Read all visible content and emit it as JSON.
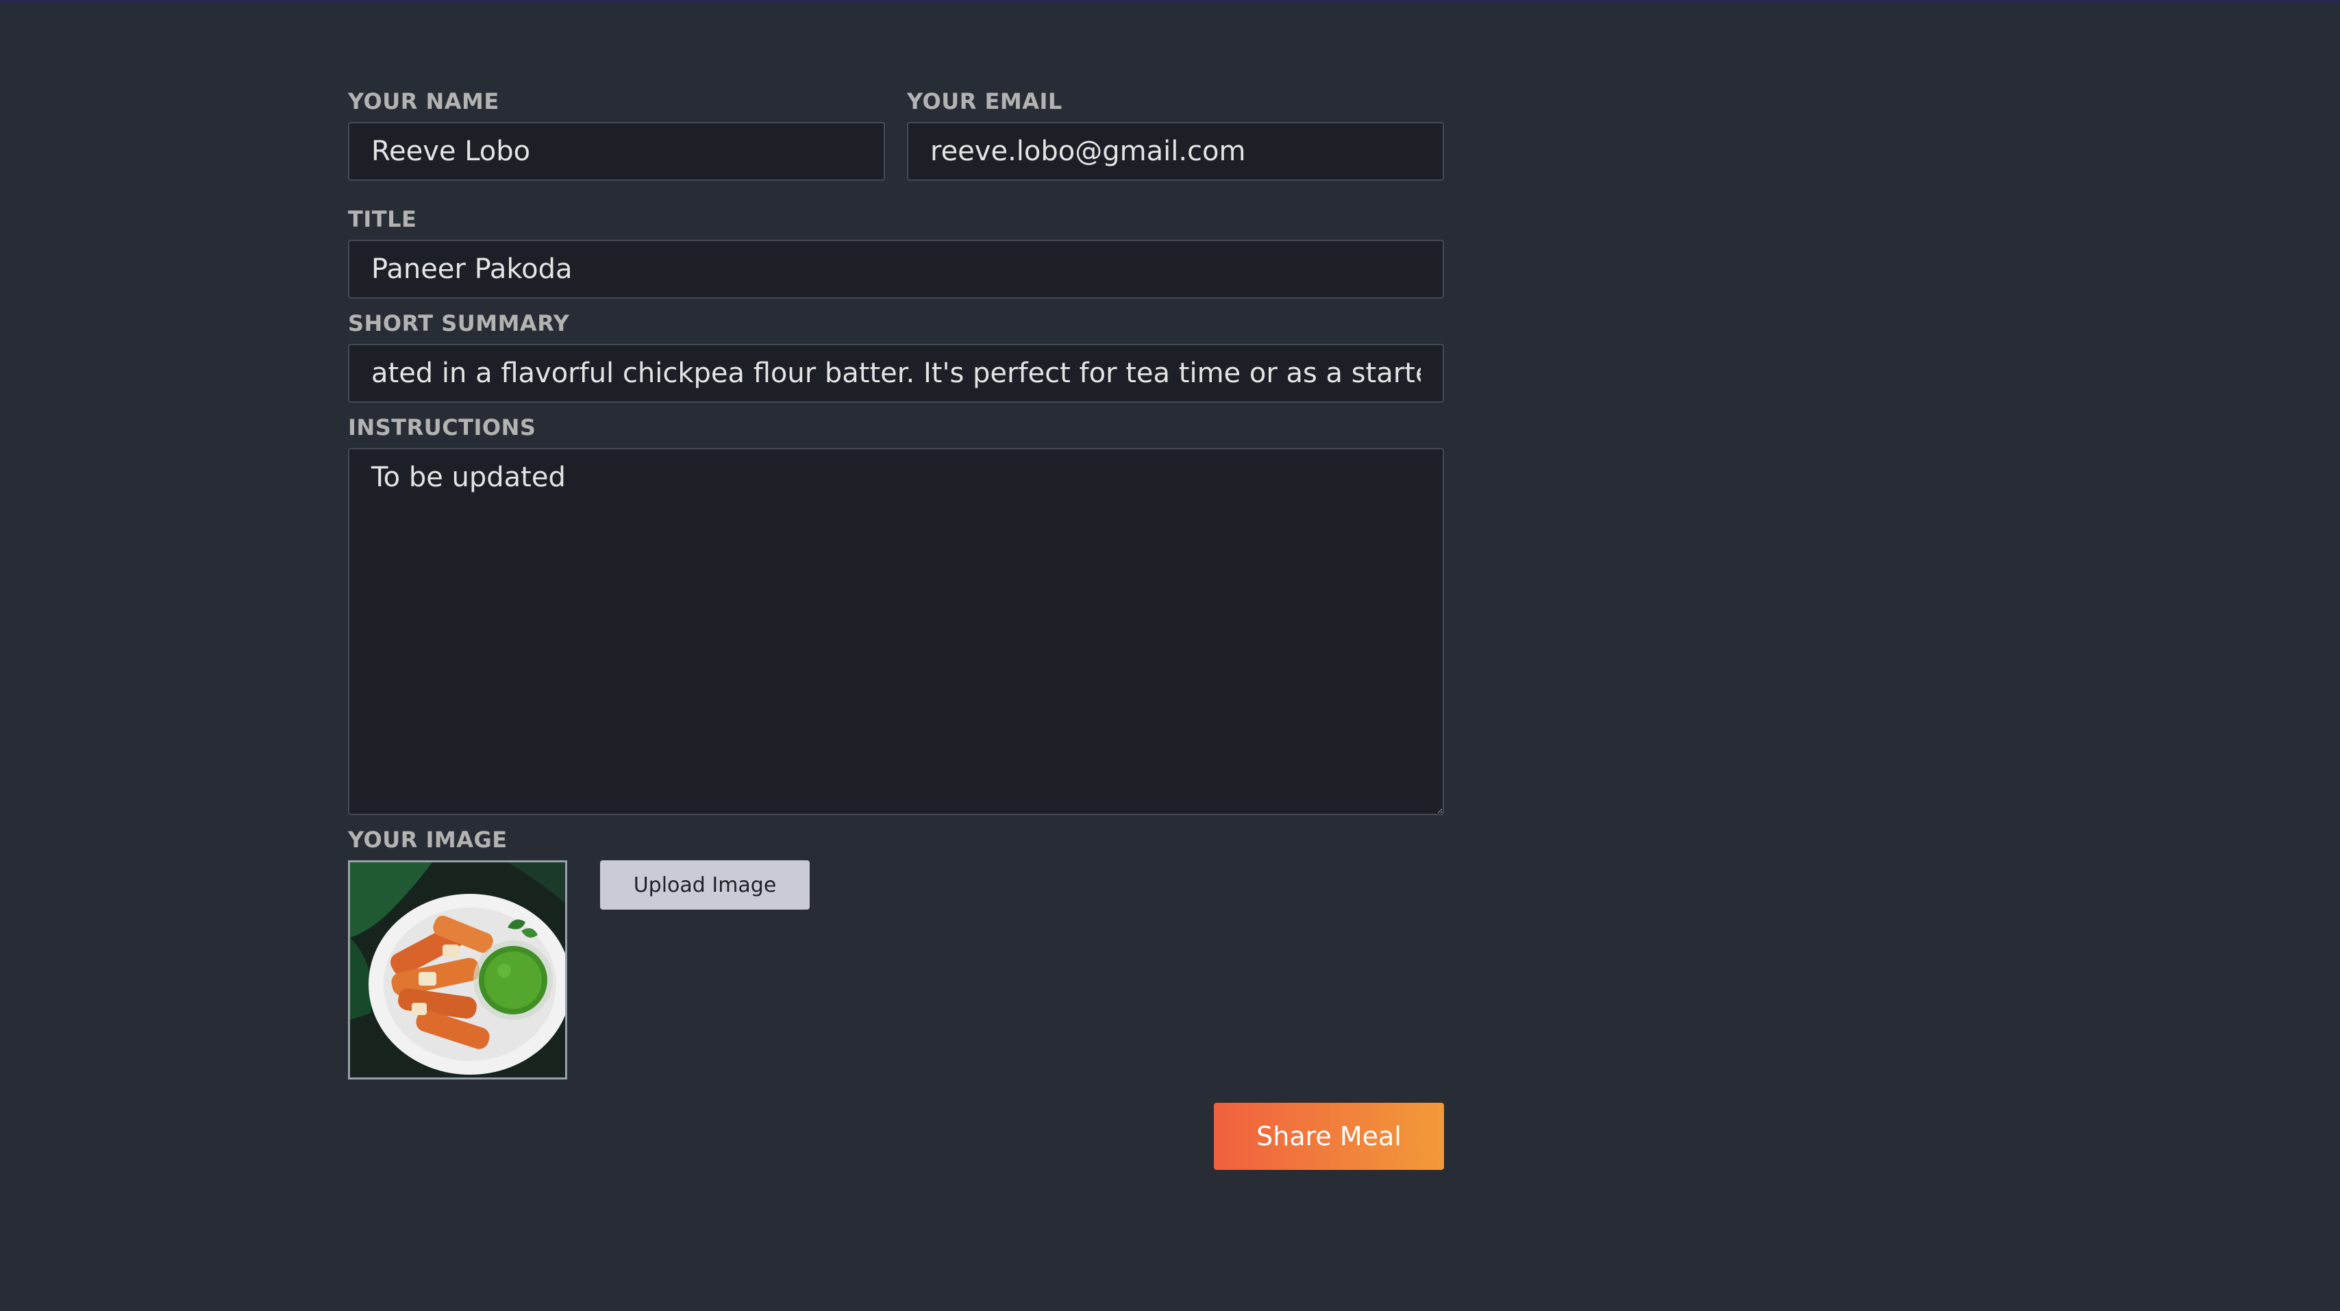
{
  "form": {
    "name": {
      "label": "Your Name",
      "value": "Reeve Lobo"
    },
    "email": {
      "label": "Your Email",
      "value": "reeve.lobo@gmail.com"
    },
    "title": {
      "label": "Title",
      "value": "Paneer Pakoda"
    },
    "summary": {
      "label": "Short Summary",
      "value": "ated in a flavorful chickpea flour batter. It's perfect for tea time or as a starter."
    },
    "instructions": {
      "label": "Instructions",
      "value": "To be updated"
    },
    "image": {
      "label": "Your Image",
      "upload_label": "Upload Image",
      "preview_icon": "food-plate-image"
    },
    "submit_label": "Share Meal"
  },
  "colors": {
    "background": "#282c34",
    "input_bg": "#1c1f25",
    "accent_start": "#f0603e",
    "accent_end": "#f29a3a"
  }
}
